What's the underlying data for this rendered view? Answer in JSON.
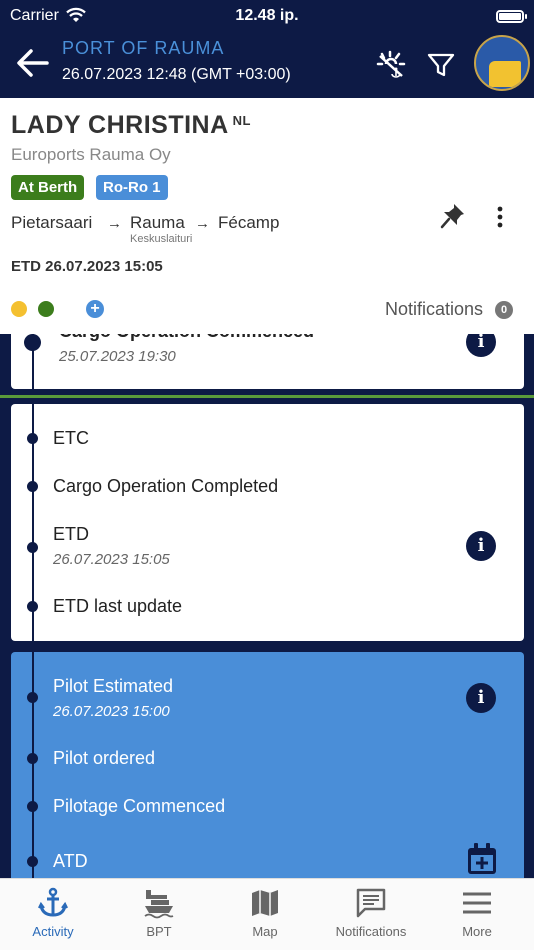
{
  "status_bar": {
    "carrier": "Carrier",
    "time": "12.48 ip."
  },
  "header": {
    "port": "PORT OF RAUMA",
    "datetime": "26.07.2023 12:48 (GMT +03:00)"
  },
  "vessel": {
    "name": "LADY CHRISTINA",
    "flag": "NL",
    "agent": "Euroports Rauma Oy",
    "badges": [
      "At Berth",
      "Ro-Ro 1"
    ],
    "route": {
      "from": "Pietarsaari",
      "via": "Rauma",
      "berth": "Keskuslaituri",
      "to": "Fécamp"
    },
    "etd_label": "ETD",
    "etd_value": "26.07.2023 15:05",
    "notifications_label": "Notifications",
    "notifications_count": "0",
    "colors": {
      "yellow": "#f4c030",
      "green": "#3c7d1c"
    }
  },
  "timeline": {
    "card1": {
      "event": "Cargo Operation Commenced",
      "time": "25.07.2023 19:30"
    },
    "card2": [
      {
        "event": "ETC"
      },
      {
        "event": "Cargo Operation Completed"
      },
      {
        "event": "ETD",
        "time": "26.07.2023 15:05"
      },
      {
        "event": "ETD last update"
      }
    ],
    "card3": [
      {
        "event": "Pilot Estimated",
        "time": "26.07.2023 15:00"
      },
      {
        "event": "Pilot ordered"
      },
      {
        "event": "Pilotage Commenced"
      },
      {
        "event": "ATD"
      }
    ]
  },
  "tabs": [
    {
      "label": "Activity",
      "icon": "anchor-icon"
    },
    {
      "label": "BPT",
      "icon": "ship-icon"
    },
    {
      "label": "Map",
      "icon": "map-icon"
    },
    {
      "label": "Notifications",
      "icon": "chat-icon"
    },
    {
      "label": "More",
      "icon": "menu-icon"
    }
  ]
}
